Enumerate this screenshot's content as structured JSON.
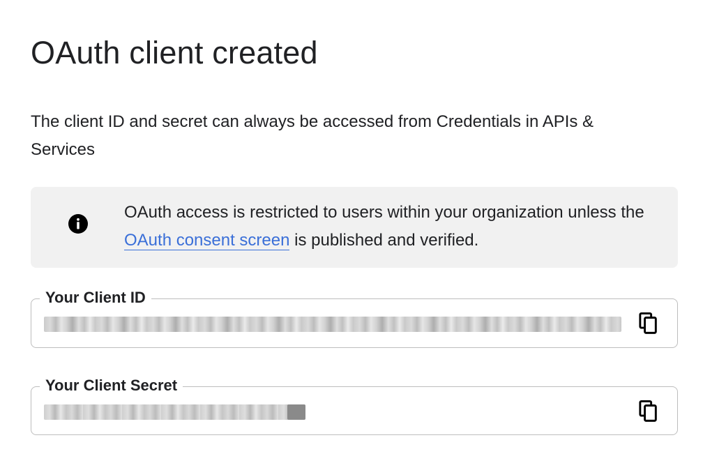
{
  "header": {
    "title": "OAuth client created"
  },
  "description": "The client ID and secret can always be accessed from Credentials in APIs & Services",
  "notice": {
    "icon": "info-icon",
    "text_before": "OAuth access is restricted to users within your organization unless the ",
    "link_text": "OAuth consent screen",
    "text_after": " is published and verified."
  },
  "fields": {
    "client_id": {
      "label": "Your Client ID",
      "copy_icon": "copy-icon"
    },
    "client_secret": {
      "label": "Your Client Secret",
      "copy_icon": "copy-icon"
    }
  },
  "colors": {
    "link": "#3a6fd8",
    "notice_background": "#f1f1f1",
    "field_border": "#bdbdbd"
  }
}
